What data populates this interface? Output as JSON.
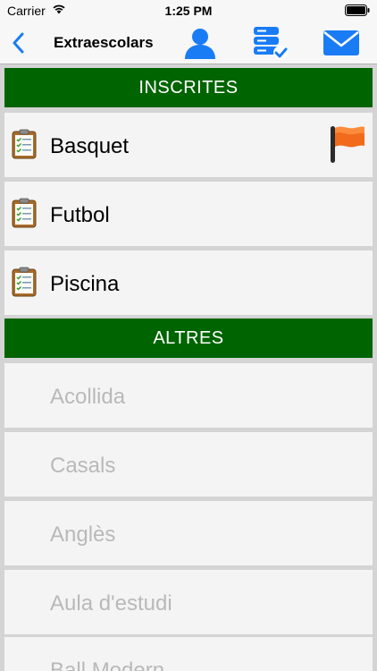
{
  "status_bar": {
    "carrier": "Carrier",
    "time": "1:25 PM"
  },
  "nav": {
    "title": "Extraescolars",
    "icons": [
      "back-chevron-icon",
      "user-icon",
      "database-check-icon",
      "mail-icon"
    ]
  },
  "colors": {
    "accent": "#1a7cf5",
    "section_header_bg": "#006400",
    "row_bg": "#f4f4f4",
    "disabled_text": "#b9b9b9"
  },
  "sections": {
    "enrolled": {
      "title": "INSCRITES",
      "items": [
        {
          "label": "Basquet",
          "flagged": true
        },
        {
          "label": "Futbol",
          "flagged": false
        },
        {
          "label": "Piscina",
          "flagged": false
        }
      ]
    },
    "others": {
      "title": "ALTRES",
      "items": [
        {
          "label": "Acollida"
        },
        {
          "label": "Casals"
        },
        {
          "label": "Anglès"
        },
        {
          "label": "Aula d'estudi"
        },
        {
          "label": "Ball Modern"
        }
      ]
    }
  }
}
